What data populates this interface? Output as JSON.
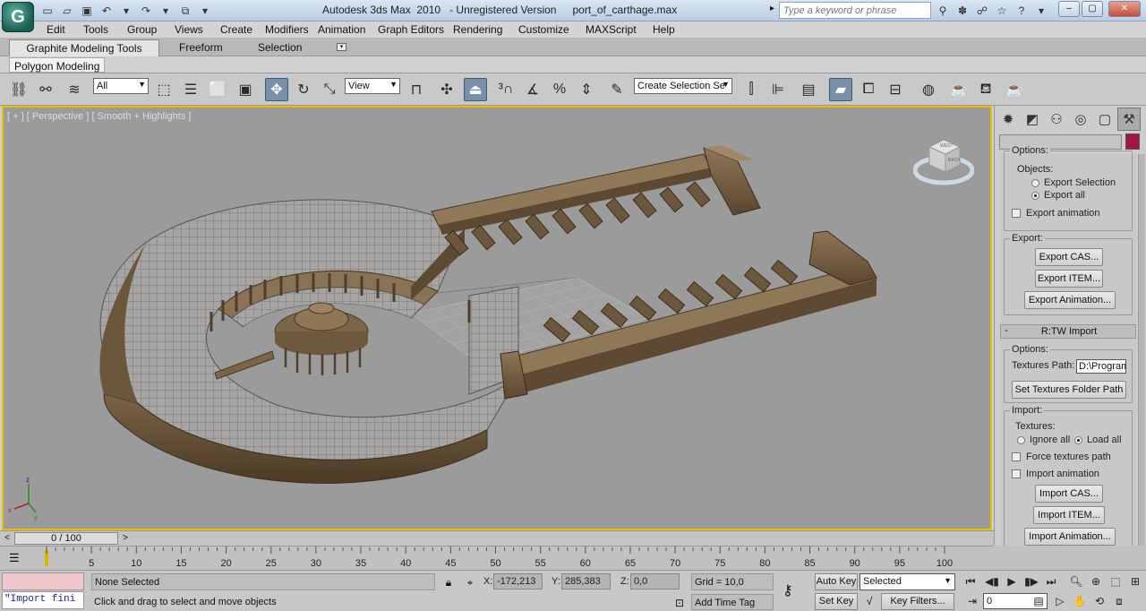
{
  "window": {
    "app_title": "Autodesk 3ds Max  2010   - Unregistered Version",
    "file_name": "port_of_carthage.max",
    "search_placeholder": "Type a keyword or phrase"
  },
  "menu": [
    "Edit",
    "Tools",
    "Group",
    "Views",
    "Create",
    "Modifiers",
    "Animation",
    "Graph Editors",
    "Rendering",
    "Customize",
    "MAXScript",
    "Help"
  ],
  "ribbon": {
    "tabs": [
      "Graphite Modeling Tools",
      "Freeform",
      "Selection"
    ],
    "active_panel": "Polygon Modeling"
  },
  "toolbar": {
    "selection_filter": "All",
    "ref_coord": "View",
    "named_selection": "Create Selection Se"
  },
  "viewport": {
    "label": "[ + ] [ Perspective ] [ Smooth + Highlights ]",
    "viewcube_top": "WEST",
    "viewcube_side": "BACK"
  },
  "command_panel": {
    "rollout1": {
      "options_title": "Options:",
      "objects_label": "Objects:",
      "radio_export_selection": "Export Selection",
      "radio_export_all": "Export all",
      "check_export_animation": "Export animation",
      "export_title": "Export:",
      "btn_export_cas": "Export CAS...",
      "btn_export_item": "Export ITEM...",
      "btn_export_animation": "Export Animation..."
    },
    "rollout2": {
      "sign": "-",
      "title": "R:TW Import",
      "options_title": "Options:",
      "textures_path_label": "Textures Path:",
      "textures_path_value": "D:\\Program",
      "btn_set_textures": "Set Textures Folder Path",
      "import_title": "Import:",
      "textures_label": "Textures:",
      "radio_ignore_all": "Ignore all",
      "radio_load_all": "Load all",
      "check_force_textures": "Force textures path",
      "check_import_animation": "Import animation",
      "btn_import_cas": "Import CAS...",
      "btn_import_item": "Import ITEM...",
      "btn_import_animation": "Import Animation..."
    }
  },
  "timeline": {
    "frame_display": "0 / 100",
    "ticks": [
      "5",
      "10",
      "15",
      "20",
      "25",
      "30",
      "35",
      "40",
      "45",
      "50",
      "55",
      "60",
      "65",
      "70",
      "75",
      "80",
      "85",
      "90",
      "95",
      "100"
    ]
  },
  "status": {
    "listener_output": "\"Import fini",
    "selection": "None Selected",
    "prompt": "Click and drag to select and move objects",
    "x_label": "X:",
    "x_value": "-172,213",
    "y_label": "Y:",
    "y_value": "285,383",
    "z_label": "Z:",
    "z_value": "0,0",
    "grid": "Grid = 10,0",
    "add_time_tag": "Add Time Tag",
    "auto_key": "Auto Key",
    "set_key": "Set Key",
    "key_mode": "Selected",
    "key_filters": "Key Filters...",
    "current_frame": "0"
  }
}
